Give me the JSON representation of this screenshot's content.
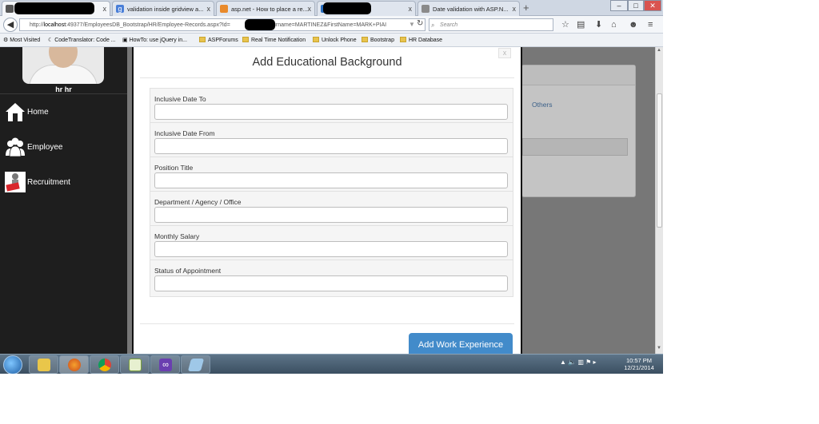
{
  "browser": {
    "tabs": [
      {
        "title": "",
        "redacted": true,
        "active": true
      },
      {
        "title": "validation inside gridview a...",
        "favicon": "google-icon"
      },
      {
        "title": "asp.net - How to place a re...",
        "favicon": "stackoverflow-icon"
      },
      {
        "title": "",
        "redacted": true
      },
      {
        "title": "Date validation with ASP.N...",
        "favicon": "page-icon"
      }
    ],
    "new_tab": "+",
    "close_glyph": "x",
    "window_buttons": {
      "minimize": "–",
      "maximize": "□",
      "close": "✕"
    },
    "url_prefix": "http://",
    "url_host": "localhost",
    "url_path": ":49377/EmployeesDB_Bootstrap/HR/Employee-Records.aspx?Id=",
    "url_suffix": "1&Surname=MARTINEZ&FirstName=MARK+PIAI",
    "search_placeholder": "Search",
    "bookmarks": [
      {
        "label": "Most Visited",
        "icon": "gear-icon"
      },
      {
        "label": "CodeTranslator: Code ...",
        "icon": "globe-icon"
      },
      {
        "label": "HowTo: use jQuery in...",
        "icon": "page-icon"
      },
      {
        "label": "ASPForums",
        "icon": "folder-icon"
      },
      {
        "label": "Real Time Notification",
        "icon": "folder-icon"
      },
      {
        "label": "Unlock Phone",
        "icon": "folder-icon"
      },
      {
        "label": "Bootstrap",
        "icon": "folder-icon"
      },
      {
        "label": "HR Database",
        "icon": "folder-icon"
      }
    ]
  },
  "sidebar": {
    "username": "hr hr",
    "items": [
      {
        "label": "Home",
        "icon": "home-icon"
      },
      {
        "label": "Employee",
        "icon": "employee-icon"
      },
      {
        "label": "Recruitment",
        "icon": "recruitment-icon"
      }
    ]
  },
  "background": {
    "tab_others": "Others"
  },
  "modal": {
    "title": "Add Educational Background",
    "close_label": "x",
    "fields": [
      {
        "label": "Inclusive Date To",
        "value": ""
      },
      {
        "label": "Inclusive Date From",
        "value": ""
      },
      {
        "label": "Position Title",
        "value": ""
      },
      {
        "label": "Department / Agency / Office",
        "value": ""
      },
      {
        "label": "Monthly Salary",
        "value": ""
      },
      {
        "label": "Status of Appointment",
        "value": ""
      }
    ],
    "submit_label": "Add Work Experience"
  },
  "taskbar": {
    "apps": [
      "explorer-icon",
      "firefox-icon",
      "chrome-icon",
      "notepad-icon",
      "visual-studio-icon",
      "generic-app-icon"
    ],
    "clock_time": "10:57 PM",
    "clock_date": "12/21/2014"
  },
  "colors": {
    "primary_button": "#428bca",
    "sidebar": "#1e1e1e",
    "overlay": "#777777"
  }
}
